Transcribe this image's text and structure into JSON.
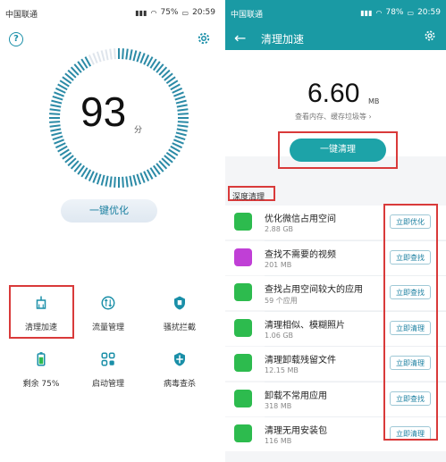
{
  "left": {
    "status": {
      "carrier": "中国联通",
      "battery": "75%",
      "time": "20:59"
    },
    "score": "93",
    "score_unit": "分",
    "optimize_button": "一键优化",
    "grid": [
      {
        "label": "清理加速",
        "icon": "broom-icon"
      },
      {
        "label": "流量管理",
        "icon": "data-traffic-icon"
      },
      {
        "label": "骚扰拦截",
        "icon": "hand-block-icon"
      },
      {
        "label": "剩余 75%",
        "icon": "battery-icon"
      },
      {
        "label": "启动管理",
        "icon": "startup-icon"
      },
      {
        "label": "病毒查杀",
        "icon": "shield-icon"
      }
    ]
  },
  "right": {
    "status": {
      "carrier": "中国联通",
      "battery": "78%",
      "time": "20:59"
    },
    "title": "清理加速",
    "size_value": "6.60",
    "size_unit": "MB",
    "size_subtitle": "查看内存、缓存垃圾等",
    "clean_button": "一键清理",
    "section_label": "深度清理",
    "items": [
      {
        "title": "优化微信占用空间",
        "sub": "2.88 GB",
        "action": "立即优化",
        "icon": "wechat-icon",
        "color": "#2dbb4e"
      },
      {
        "title": "查找不需要的视频",
        "sub": "201 MB",
        "action": "立即查找",
        "icon": "video-icon",
        "color": "#c03fd6"
      },
      {
        "title": "查找占用空间较大的应用",
        "sub": "59 个应用",
        "action": "立即查找",
        "icon": "apps-icon",
        "color": "#2dbb4e"
      },
      {
        "title": "清理相似、模糊照片",
        "sub": "1.06 GB",
        "action": "立即清理",
        "icon": "photo-icon",
        "color": "#2dbb4e"
      },
      {
        "title": "清理卸载残留文件",
        "sub": "12.15 MB",
        "action": "立即清理",
        "icon": "residue-icon",
        "color": "#2dbb4e"
      },
      {
        "title": "卸载不常用应用",
        "sub": "318 MB",
        "action": "立即查找",
        "icon": "uninstall-icon",
        "color": "#2dbb4e"
      },
      {
        "title": "清理无用安装包",
        "sub": "116 MB",
        "action": "立即清理",
        "icon": "package-icon",
        "color": "#2dbb4e"
      }
    ]
  },
  "colors": {
    "accent": "#1a9aa4",
    "highlight": "#d93a3a"
  }
}
